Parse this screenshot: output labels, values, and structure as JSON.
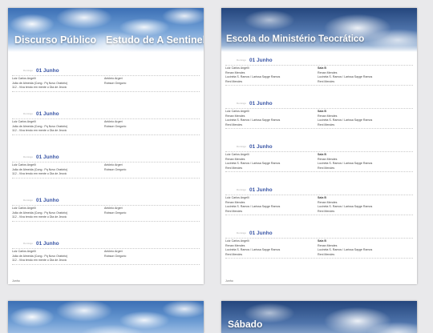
{
  "page1": {
    "header_left": "Discurso Público",
    "header_right": "Estudo de A Sentinela",
    "footer": "Junho",
    "sections": [
      {
        "date": "01 Junho",
        "speaker": "Luiz Carlos Angelli",
        "congregation": "João de Almeida (Cong.: Pq Novo Oratório)",
        "theme": "112 - Viva tendo em mente o Dia de Jeová",
        "reader": "Antônio Argeri",
        "conductor": "Robson Gregorio"
      },
      {
        "date": "01 Junho",
        "speaker": "Luiz Carlos Angelli",
        "congregation": "João de Almeida (Cong.: Pq Novo Oratório)",
        "theme": "112 - Viva tendo em mente o Dia de Jeová",
        "reader": "Antônio Argeri",
        "conductor": "Robson Gregorio"
      },
      {
        "date": "01 Junho",
        "speaker": "Luiz Carlos Angelli",
        "congregation": "João de Almeida (Cong.: Pq Novo Oratório)",
        "theme": "112 - Viva tendo em mente o Dia de Jeová",
        "reader": "Antônio Argeri",
        "conductor": "Robson Gregorio"
      },
      {
        "date": "01 Junho",
        "speaker": "Luiz Carlos Angelli",
        "congregation": "João de Almeida (Cong.: Pq Novo Oratório)",
        "theme": "112 - Viva tendo em mente o Dia de Jeová",
        "reader": "Antônio Argeri",
        "conductor": "Robson Gregorio"
      },
      {
        "date": "01 Junho",
        "speaker": "Luiz Carlos Angelli",
        "congregation": "João de Almeida (Cong.: Pq Novo Oratório)",
        "theme": "112 - Viva tendo em mente o Dia de Jeová",
        "reader": "Antônio Argeri",
        "conductor": "Robson Gregorio"
      }
    ]
  },
  "page2": {
    "header": "Escola do Ministério Teocrático",
    "footer": "Junho",
    "sections": [
      {
        "date": "01 Junho",
        "l1": "Luiz Carlos Angelli",
        "l2": "Renan Mendes",
        "l3": "Lucinéia S. Ramos / Larissa Sayge Ramos",
        "l4": "Reni Mendes",
        "r1": "Sala B",
        "r2": "Renan Mendes",
        "r3": "Lucinéia S. Ramos / Larissa Sayge Ramos",
        "r4": "Reni Mendes"
      },
      {
        "date": "01 Junho",
        "l1": "Luiz Carlos Angelli",
        "l2": "Renan Mendes",
        "l3": "Lucinéia S. Ramos / Larissa Sayge Ramos",
        "l4": "Reni Mendes",
        "r1": "Sala B",
        "r2": "Renan Mendes",
        "r3": "Lucinéia S. Ramos / Larissa Sayge Ramos",
        "r4": "Reni Mendes"
      },
      {
        "date": "01 Junho",
        "l1": "Luiz Carlos Angelli",
        "l2": "Renan Mendes",
        "l3": "Lucinéia S. Ramos / Larissa Sayge Ramos",
        "l4": "Reni Mendes",
        "r1": "Sala B",
        "r2": "Renan Mendes",
        "r3": "Lucinéia S. Ramos / Larissa Sayge Ramos",
        "r4": "Reni Mendes"
      },
      {
        "date": "01 Junho",
        "l1": "Luiz Carlos Angelli",
        "l2": "Renan Mendes",
        "l3": "Lucinéia S. Ramos / Larissa Sayge Ramos",
        "l4": "Reni Mendes",
        "r1": "Sala B",
        "r2": "Renan Mendes",
        "r3": "Lucinéia S. Ramos / Larissa Sayge Ramos",
        "r4": "Reni Mendes"
      },
      {
        "date": "01 Junho",
        "l1": "Luiz Carlos Angelli",
        "l2": "Renan Mendes",
        "l3": "Lucinéia S. Ramos / Larissa Sayge Ramos",
        "l4": "Reni Mendes",
        "r1": "Sala B",
        "r2": "Renan Mendes",
        "r3": "Lucinéia S. Ramos / Larissa Sayge Ramos",
        "r4": "Reni Mendes"
      }
    ]
  },
  "page4": {
    "header": "Sábado"
  }
}
